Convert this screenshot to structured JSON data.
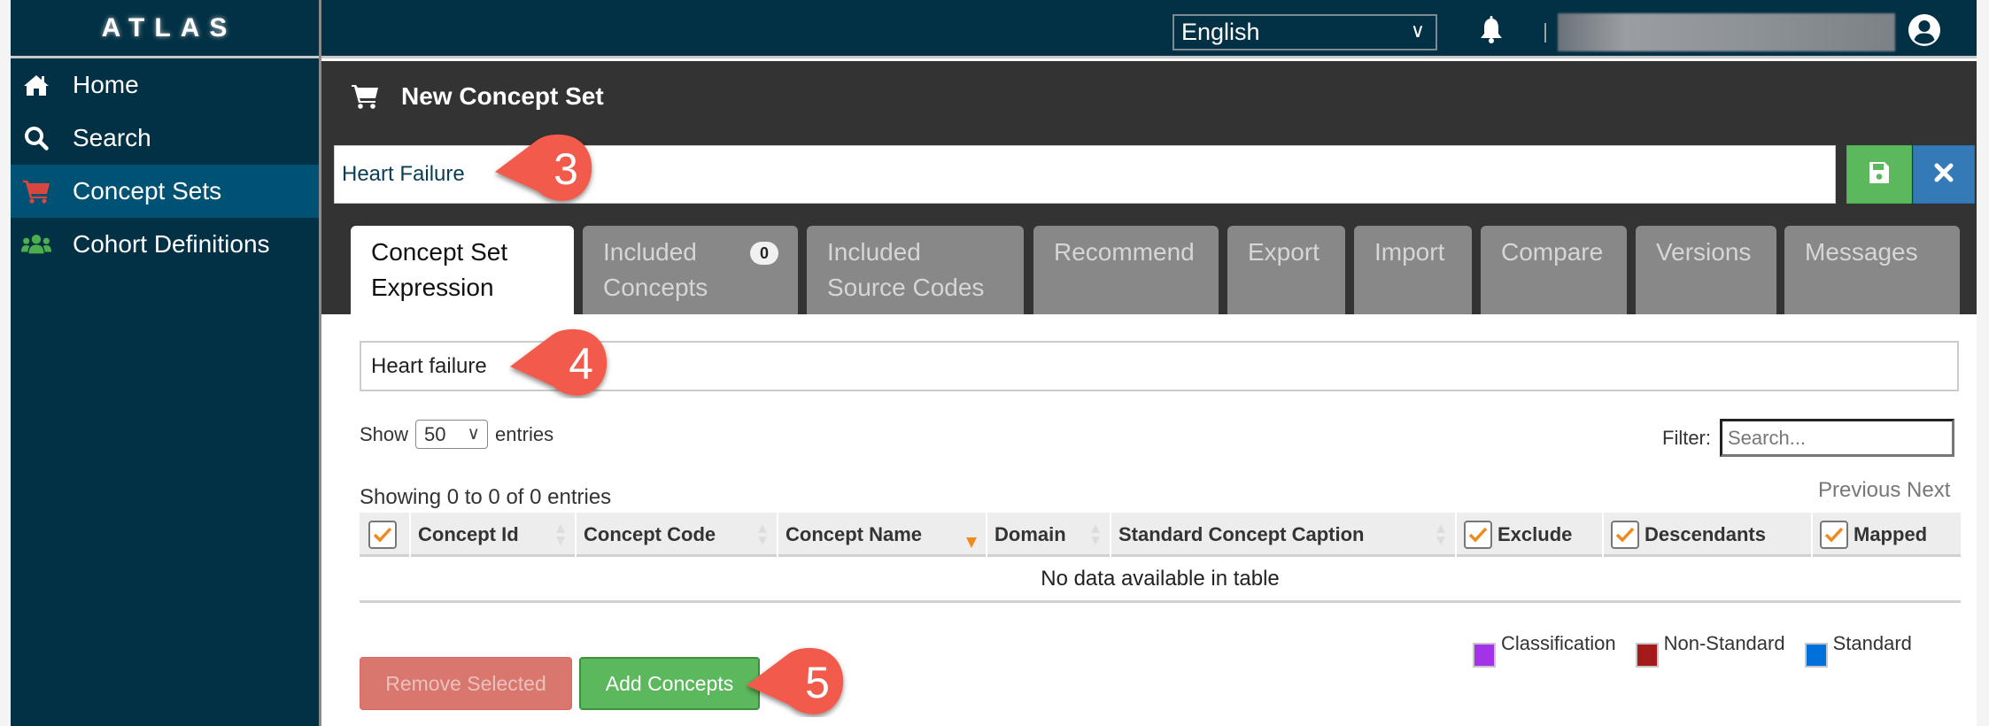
{
  "sidebar": {
    "brand": "ATLAS",
    "items": [
      {
        "label": "Home",
        "icon": "home-icon"
      },
      {
        "label": "Search",
        "icon": "search-icon"
      },
      {
        "label": "Concept Sets",
        "icon": "cart-icon",
        "active": true
      },
      {
        "label": "Cohort Definitions",
        "icon": "users-icon"
      }
    ]
  },
  "topbar": {
    "language": "English",
    "notifications_icon": "bell-icon",
    "user_icon": "user-circle-icon"
  },
  "header": {
    "title": "New Concept Set",
    "concept_set_name": "Heart Failure",
    "save_icon": "floppy-disk-icon",
    "close_icon": "close-icon"
  },
  "tabs": [
    {
      "label": "Concept Set Expression",
      "line1": "Concept Set",
      "line2": "Expression",
      "active": true
    },
    {
      "label": "Included Concepts",
      "line1": "Included",
      "line2": "Concepts",
      "badge": "0"
    },
    {
      "label": "Included Source Codes",
      "line1": "Included",
      "line2": "Source Codes"
    },
    {
      "label": "Recommend",
      "line1": "Recommend",
      "line2": ""
    },
    {
      "label": "Export",
      "line1": "Export",
      "line2": ""
    },
    {
      "label": "Import",
      "line1": "Import",
      "line2": ""
    },
    {
      "label": "Compare",
      "line1": "Compare",
      "line2": ""
    },
    {
      "label": "Versions",
      "line1": "Versions",
      "line2": ""
    },
    {
      "label": "Messages",
      "line1": "Messages",
      "line2": ""
    }
  ],
  "expression": {
    "search_value": "Heart failure"
  },
  "table": {
    "show_label": "Show",
    "page_length": "50",
    "entries_label": "entries",
    "filter_label": "Filter:",
    "filter_placeholder": "Search...",
    "info": "Showing 0 to 0 of 0 entries",
    "previous": "Previous",
    "next": "Next",
    "columns": [
      {
        "label": "",
        "checkbox": true
      },
      {
        "label": "Concept Id"
      },
      {
        "label": "Concept Code"
      },
      {
        "label": "Concept Name",
        "sorted": "desc"
      },
      {
        "label": "Domain"
      },
      {
        "label": "Standard Concept Caption"
      },
      {
        "label": "Exclude",
        "checkbox": true
      },
      {
        "label": "Descendants",
        "checkbox": true
      },
      {
        "label": "Mapped",
        "checkbox": true
      }
    ],
    "empty_message": "No data available in table"
  },
  "actions": {
    "remove_selected": "Remove Selected",
    "add_concepts": "Add Concepts"
  },
  "legend": [
    {
      "label": "Classification",
      "color": "#a333e8"
    },
    {
      "label": "Non-Standard",
      "color": "#a51b1b"
    },
    {
      "label": "Standard",
      "color": "#0070dd"
    }
  ],
  "callouts": [
    {
      "number": "3",
      "color": "#f25a4c"
    },
    {
      "number": "4",
      "color": "#f25a4c"
    },
    {
      "number": "5",
      "color": "#f25a4c"
    }
  ],
  "colors": {
    "sidebar_bg": "#023044",
    "sidebar_active": "#005274",
    "accent_orange": "#f0891e",
    "success": "#5cb85c",
    "primary": "#337ab7"
  }
}
